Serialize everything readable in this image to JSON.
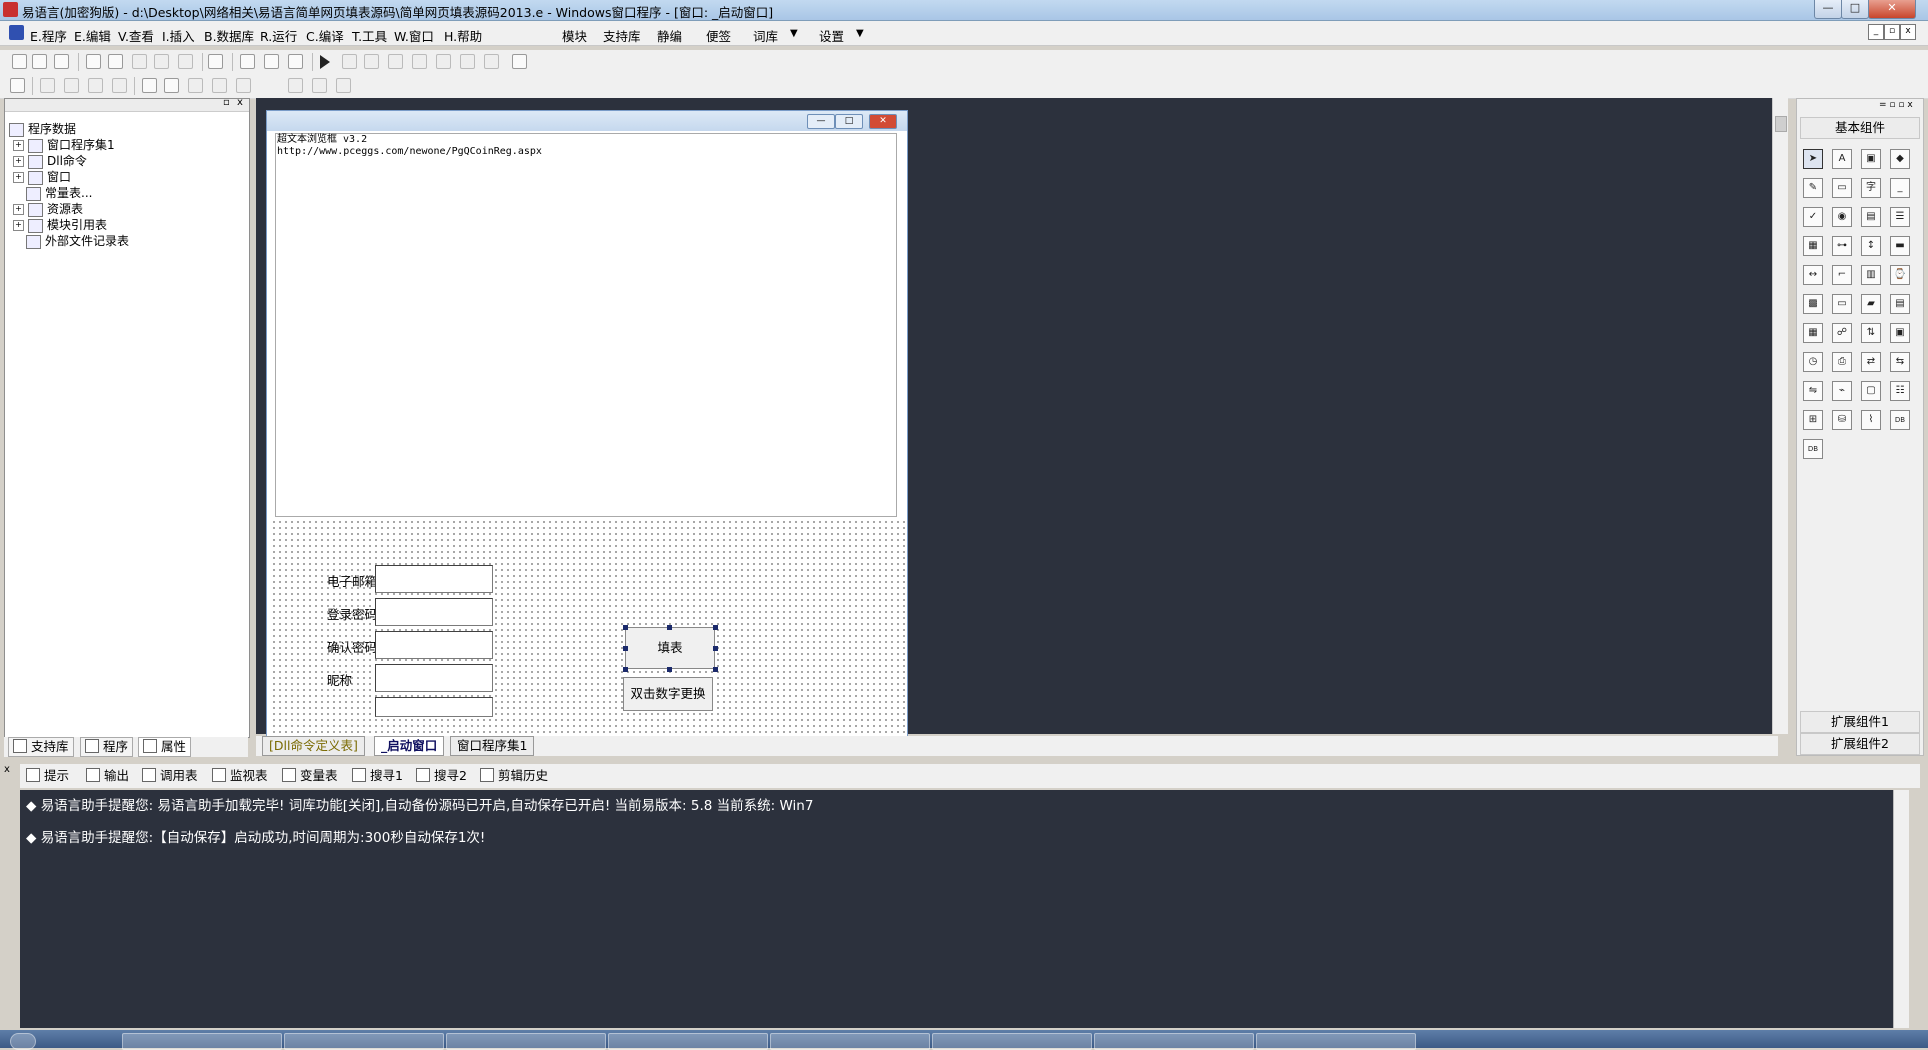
{
  "window": {
    "title": "易语言(加密狗版) - d:\\Desktop\\网络相关\\易语言简单网页填表源码\\简单网页填表源码2013.e - Windows窗口程序 - [窗口: _启动窗口]",
    "min_label": "—",
    "max_label": "□",
    "close_label": "✕"
  },
  "menu": {
    "items": [
      "E.程序",
      "E.编辑",
      "V.查看",
      "I.插入",
      "B.数据库",
      "R.运行",
      "C.编译",
      "T.工具",
      "W.窗口",
      "H.帮助"
    ],
    "extras": [
      "模块",
      "支持库",
      "静编",
      "便签",
      "词库",
      "设置"
    ],
    "dropdown_arrow": "▼"
  },
  "left_panel": {
    "tree": [
      {
        "label": "程序数据",
        "expander": ""
      },
      {
        "label": "窗口程序集1",
        "expander": "+"
      },
      {
        "label": "Dll命令",
        "expander": "+"
      },
      {
        "label": "窗口",
        "expander": "+"
      },
      {
        "label": "常量表...",
        "expander": ""
      },
      {
        "label": "资源表",
        "expander": "+"
      },
      {
        "label": "模块引用表",
        "expander": "+"
      },
      {
        "label": "外部文件记录表",
        "expander": ""
      }
    ],
    "tabs": [
      "支持库",
      "程序",
      "属性"
    ]
  },
  "form": {
    "browser_line1": "超文本浏览框 v3.2",
    "browser_line2": "http://www.pceggs.com/newone/PgQCoinReg.aspx",
    "labels": [
      "电子邮箱",
      "登录密码",
      "确认密码",
      "昵称"
    ],
    "fill_button": "填表",
    "swap_button": "双击数字更换"
  },
  "doc_tabs": [
    "[Dll命令定义表]",
    "_启动窗口",
    "窗口程序集1"
  ],
  "right_panel": {
    "basic": "基本组件",
    "ext1": "扩展组件1",
    "ext2": "扩展组件2"
  },
  "bottom_tabs": [
    "提示",
    "输出",
    "调用表",
    "监视表",
    "变量表",
    "搜寻1",
    "搜寻2",
    "剪辑历史"
  ],
  "output": {
    "bullet": "◆",
    "line1": "易语言助手提醒您:  易语言助手加载完毕! 词库功能[关闭],自动备份源码已开启,自动保存已开启!  当前易版本: 5.8  当前系统: Win7",
    "line2": "易语言助手提醒您:【自动保存】启动成功,时间周期为:300秒自动保存1次!"
  },
  "colors": {
    "dark_bg": "#2c313d",
    "panel_bg": "#f0f0f0",
    "close_red": "#c8452c"
  }
}
